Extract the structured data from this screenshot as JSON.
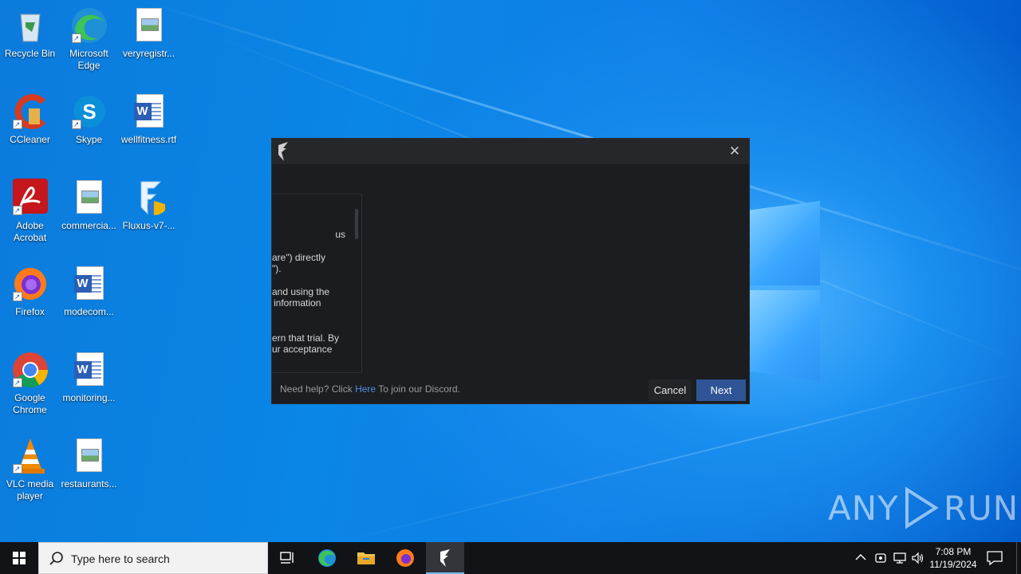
{
  "desktop": {
    "icons": [
      {
        "label": "Recycle Bin"
      },
      {
        "label": "Microsoft Edge"
      },
      {
        "label": "veryregistr..."
      },
      {
        "label": "CCleaner"
      },
      {
        "label": "Skype"
      },
      {
        "label": "wellfitness.rtf"
      },
      {
        "label": "Adobe Acrobat"
      },
      {
        "label": "commercia..."
      },
      {
        "label": "Fluxus-v7-..."
      },
      {
        "label": "Firefox"
      },
      {
        "label": "modecom..."
      },
      {
        "label": "Google Chrome"
      },
      {
        "label": "monitoring..."
      },
      {
        "label": "VLC media player"
      },
      {
        "label": "restaurants..."
      }
    ],
    "watermark": {
      "left": "ANY",
      "right": "RUN"
    }
  },
  "dialog": {
    "close_label": "✕",
    "license_lines": [
      "us",
      "are\") directly",
      "\").",
      "and using the",
      "information",
      "ern that trial. By",
      "ur acceptance"
    ],
    "help": {
      "prefix": "Need help? Click ",
      "link": "Here",
      "suffix": " To join our Discord."
    },
    "cancel_label": "Cancel",
    "next_label": "Next"
  },
  "taskbar": {
    "search_placeholder": "Type here to search",
    "time": "7:08 PM",
    "date": "11/19/2024"
  },
  "colors": {
    "accent_blue": "#2f5596",
    "link_blue": "#4a8fe0",
    "dialog_bg": "#1c1d20",
    "taskbar_bg": "#111317"
  }
}
